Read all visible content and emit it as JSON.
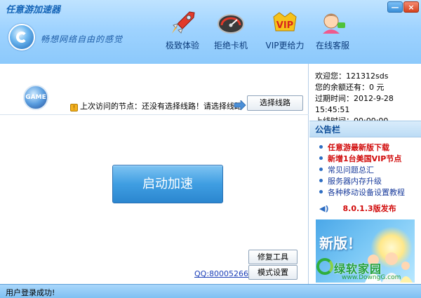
{
  "window": {
    "title": "任意游加速器",
    "minimize_label": "—",
    "close_label": "×"
  },
  "header": {
    "slogan": "畅想网络自由的感觉",
    "nav": [
      {
        "label": "极致体验",
        "icon": "rocket-icon"
      },
      {
        "label": "拒绝卡机",
        "icon": "speedometer-icon"
      },
      {
        "label": "VIP更给力",
        "icon": "vip-icon"
      },
      {
        "label": "在线客服",
        "icon": "customer-service-icon"
      }
    ]
  },
  "main": {
    "game_badge": "GAME",
    "node_label": "上次访问的节点：",
    "node_status": "还没有选择线路！",
    "node_hint": "请选择线路",
    "select_line_button": "选择线路",
    "start_button": "启动加速",
    "qq_link": "QQ:800052665",
    "repair_button": "修复工具",
    "mode_button": "模式设置"
  },
  "user": {
    "welcome": "欢迎您：121312sds",
    "balance": "您的余额还有：0 元",
    "expire": "过期时间：2012-9-28 15:45:51",
    "online": "上线时间：00:00:00"
  },
  "notice": {
    "title": "公告栏",
    "items": [
      {
        "text": "任意游最新版下载",
        "style": "red"
      },
      {
        "text": "新增1台美国VIP节点",
        "style": "red"
      },
      {
        "text": "常见问题总汇",
        "style": "blue"
      },
      {
        "text": "服务器内存升级",
        "style": "blue"
      },
      {
        "text": "各种移动设备设置教程",
        "style": "blue"
      }
    ],
    "version": "8.0.1.3版发布"
  },
  "ad": {
    "headline": "新版！"
  },
  "watermark": {
    "text": "绿软家园",
    "url": "www.DowngG.com"
  },
  "status_bar": {
    "text": "用户登录成功!"
  },
  "colors": {
    "header_bg": "#9fd3ff",
    "accent": "#2b86cf",
    "notice_red": "#d10a0a",
    "link_blue": "#1a3c9c"
  }
}
